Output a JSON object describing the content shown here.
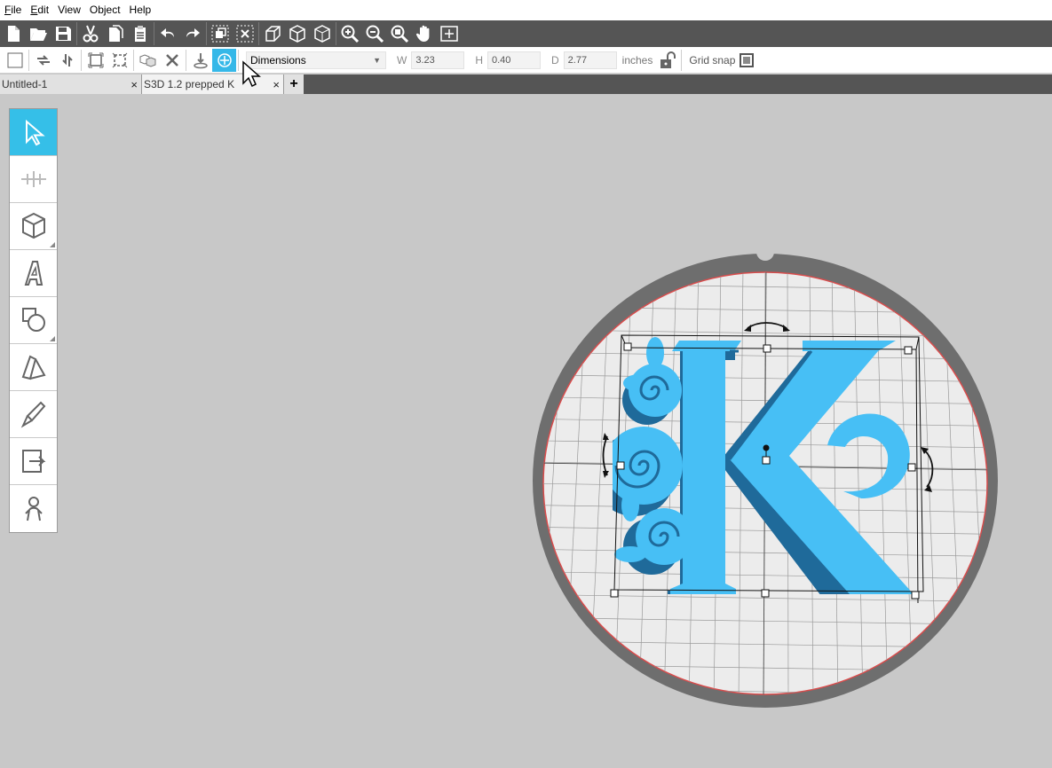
{
  "menu": {
    "items": [
      "File",
      "Edit",
      "View",
      "Object",
      "Help"
    ],
    "underline": [
      "F",
      "E",
      "",
      "",
      ""
    ]
  },
  "toolbar": {
    "buttons": [
      "new-file-icon",
      "open-folder-icon",
      "save-icon",
      "cut-icon",
      "copy-icon",
      "paste-icon",
      "undo-icon",
      "redo-icon",
      "group-icon",
      "ungroup-icon",
      "extrude-icon",
      "cube-view-icon",
      "cube-outline-icon",
      "zoom-in-icon",
      "zoom-out-icon",
      "zoom-fit-icon",
      "pan-hand-icon",
      "add-frame-icon"
    ]
  },
  "properties": {
    "dimension_mode": "Dimensions",
    "w_label": "W",
    "w_value": "3.23",
    "h_label": "H",
    "h_value": "0.40",
    "d_label": "D",
    "d_value": "2.77",
    "units": "inches",
    "grid_snap_label": "Grid snap"
  },
  "tabs": [
    {
      "label": "Untitled-1",
      "close": "×"
    },
    {
      "label": "S3D 1.2 prepped K",
      "close": "×"
    }
  ],
  "tab_add": "+",
  "left_tools": [
    "select-arrow-icon",
    "align-icon",
    "cube-icon",
    "text-3d-icon",
    "shape-icon",
    "faces-icon",
    "knife-icon",
    "export-icon",
    "figure-icon"
  ],
  "viewport": {
    "object_letter": "K",
    "colors": {
      "object": "#47bff5",
      "object_shadow": "#1f6a9a",
      "bed": "#ececec",
      "bed_rim": "#6e6e6e",
      "bed_edge": "#d94c4c",
      "active_tool": "#35bfe8"
    }
  }
}
